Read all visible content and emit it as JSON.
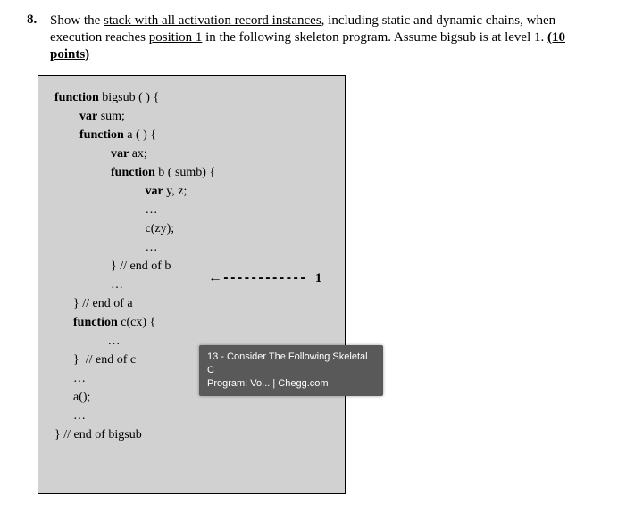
{
  "question": {
    "number": "8.",
    "text_pre": "Show the ",
    "text_u1": "stack with all activation record instances",
    "text_mid1": ", including static and dynamic chains, when execution reaches ",
    "text_u2": "position 1",
    "text_mid2": " in the following skeleton program. Assume bigsub is at level 1.  ",
    "points": "(10 points)"
  },
  "arrow": {
    "head": "←",
    "dashes": "------------",
    "label": "1"
  },
  "code": {
    "l1a": "function",
    "l1b": " bigsub ( ) {",
    "l2a": "        var",
    "l2b": " sum;",
    "l3a": "        function",
    "l3b": " a ( ) {",
    "l4a": "                  var",
    "l4b": " ax;",
    "l5a": "                  function",
    "l5b": " b ( sumb) {",
    "l6a": "                             var",
    "l6b": " y, z;",
    "l7": "                             …",
    "l8": "                             c(zy);",
    "l9": "                             …",
    "l10": "                  } // end of b",
    "l11": "                  …",
    "l12": "      } // end of a",
    "l13": "",
    "l14a": "      function",
    "l14b": " c(cx) {",
    "l15": "                 …",
    "l16": "      }  // end of c",
    "l17": "      …",
    "l18": "      a();",
    "l19": "      …",
    "l20": "} // end of bigsub"
  },
  "tooltip": {
    "line1": "13 - Consider The Following Skeletal C",
    "line2": "Program: Vo... | Chegg.com"
  }
}
